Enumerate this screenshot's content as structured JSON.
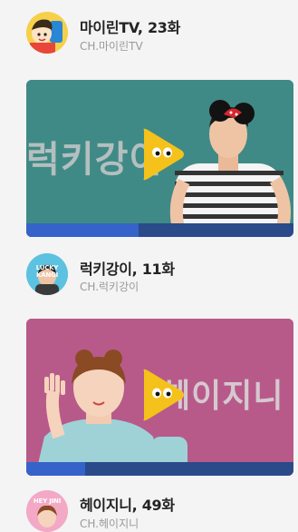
{
  "items": [
    {
      "title": "마이린TV, 23화",
      "channel": "CH.마이린TV"
    },
    {
      "title": "럭키강이, 11화",
      "channel": "CH.럭키강이",
      "thumb_text": "럭키강이",
      "avatar_label": "LUCKY KANGI",
      "progress": 0.42,
      "thumb_color": "#3f8a86"
    },
    {
      "title": "헤이지니, 49화",
      "channel": "CH.헤이지니",
      "thumb_text": "헤이지니",
      "avatar_label": "HEY JINI",
      "progress": 0.22,
      "thumb_color": "#b75a8a"
    }
  ],
  "colors": {
    "play_yellow": "#f4c21a",
    "progress_track": "#2a4a8a",
    "progress_fill": "#3563c9"
  },
  "icons": [
    "play-icon"
  ]
}
